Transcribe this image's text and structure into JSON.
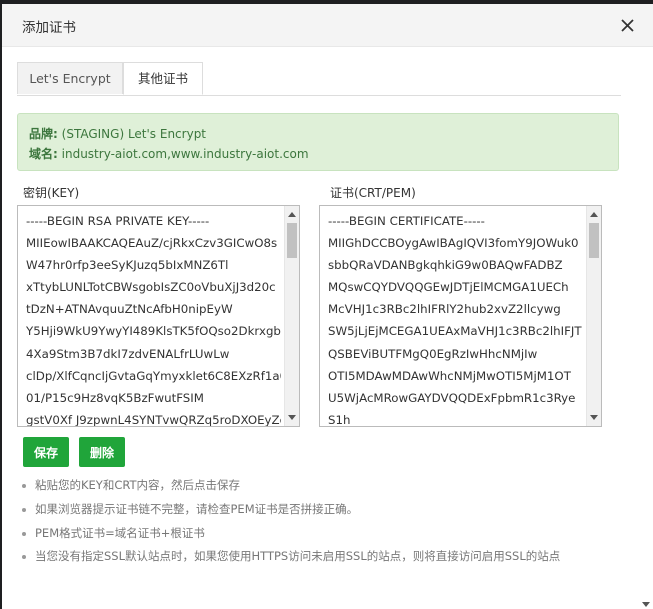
{
  "dialog": {
    "title": "添加证书"
  },
  "tabs": [
    {
      "label": "Let's Encrypt",
      "active": false
    },
    {
      "label": "其他证书",
      "active": true
    }
  ],
  "info": {
    "brand_label": "品牌:",
    "brand_value": "(STAGING) Let's Encrypt",
    "domain_label": "域名:",
    "domain_value": "industry-aiot.com,www.industry-aiot.com"
  },
  "key_field": {
    "label": "密钥(KEY)",
    "lines": [
      "-----BEGIN RSA PRIVATE KEY-----",
      "MIIEowIBAAKCAQEAuZ/cjRkxCzv3GICwO8s",
      "W47hr0rfp3eeSyKJuzq5bIxMNZ6Tl",
      "xTtybLUNLTotCBWsgobIsZC0oVbuXjJ3d20c",
      "tDzN+ATNAvquuZtNcAfbH0nipEyW",
      "Y5Hji9WkU9YwyYI489KlsTK5fOQso2Dkrxgb",
      "4Xa9Stm3B7dkI7zdvENALfrLUwLw",
      "clDp/XlfCqncIjGvtaGqYmyxklet6C8EXzRf1a0",
      "01/P15c9Hz8vqK5BzFwutFSIM",
      "gstV0Xf J9zpwnL4SYNTvwQRZq5roDXOEyZc"
    ]
  },
  "cert_field": {
    "label": "证书(CRT/PEM)",
    "lines": [
      "-----BEGIN CERTIFICATE-----",
      "MIIGhDCCBOygAwIBAgIQVI3fomY9JOWuk0",
      "sbbQRaVDANBgkqhkiG9w0BAQwFADBZ",
      "MQswCQYDVQQGEwJDTjElMCMGA1UECh",
      "McVHJ1c3RBc2lhIFRlY2hub2xvZ2llcywg",
      "SW5jLjEjMCEGA1UEAxMaVHJ1c3RBc2lhIFJT",
      "QSBEViBUTFMgQ0EgRzIwHhcNMjIw",
      "OTI5MDAwMDAwWhcNMjMwOTI5MjM1OT",
      "U5WjAcMRowGAYDVQQDExFpbmR1c3Rye",
      "S1h"
    ]
  },
  "buttons": {
    "save": "保存",
    "delete": "删除"
  },
  "tips": [
    "粘贴您的KEY和CRT内容，然后点击保存",
    "如果浏览器提示证书链不完整，请检查PEM证书是否拼接正确。",
    "PEM格式证书=域名证书+根证书",
    "当您没有指定SSL默认站点时，如果您使用HTTPS访问未启用SSL的站点，则将直接访问启用SSL的站点"
  ],
  "colors": {
    "accent": "#20a53a",
    "info_bg": "#dff0d8",
    "info_text": "#3c763d"
  },
  "icons": {
    "close": "close-icon"
  }
}
